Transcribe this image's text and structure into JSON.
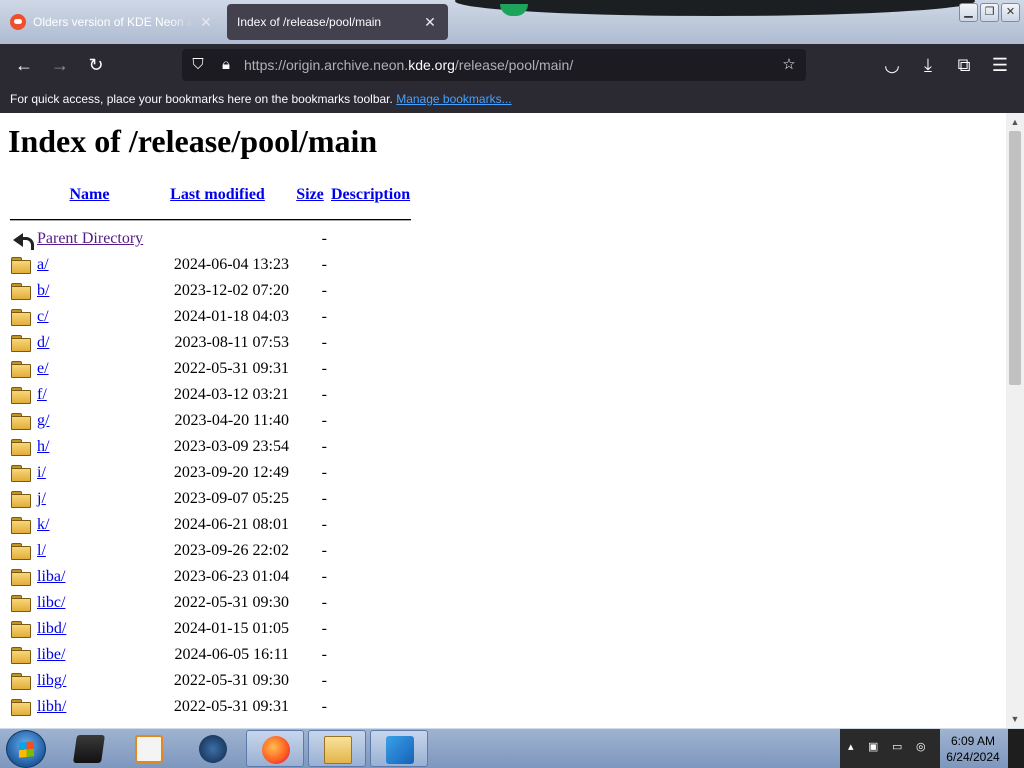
{
  "browser": {
    "tabs": [
      {
        "title": "Olders version of KDE Neon available",
        "active": false
      },
      {
        "title": "Index of /release/pool/main",
        "active": true
      }
    ],
    "url_prefix": "https://origin.archive.neon.",
    "url_domain": "kde.org",
    "url_suffix": "/release/pool/main/",
    "bookmarks_text": "For quick access, place your bookmarks here on the bookmarks toolbar.",
    "manage_bookmarks_label": "Manage bookmarks..."
  },
  "page": {
    "heading": "Index of /release/pool/main",
    "columns": {
      "name": "Name",
      "last_modified": "Last modified",
      "size": "Size",
      "description": "Description"
    },
    "parent": {
      "name": "Parent Directory",
      "size": "-"
    },
    "rows": [
      {
        "name": "a/",
        "modified": "2024-06-04 13:23",
        "size": "-"
      },
      {
        "name": "b/",
        "modified": "2023-12-02 07:20",
        "size": "-"
      },
      {
        "name": "c/",
        "modified": "2024-01-18 04:03",
        "size": "-"
      },
      {
        "name": "d/",
        "modified": "2023-08-11 07:53",
        "size": "-"
      },
      {
        "name": "e/",
        "modified": "2022-05-31 09:31",
        "size": "-"
      },
      {
        "name": "f/",
        "modified": "2024-03-12 03:21",
        "size": "-"
      },
      {
        "name": "g/",
        "modified": "2023-04-20 11:40",
        "size": "-"
      },
      {
        "name": "h/",
        "modified": "2023-03-09 23:54",
        "size": "-"
      },
      {
        "name": "i/",
        "modified": "2023-09-20 12:49",
        "size": "-"
      },
      {
        "name": "j/",
        "modified": "2023-09-07 05:25",
        "size": "-"
      },
      {
        "name": "k/",
        "modified": "2024-06-21 08:01",
        "size": "-"
      },
      {
        "name": "l/",
        "modified": "2023-09-26 22:02",
        "size": "-"
      },
      {
        "name": "liba/",
        "modified": "2023-06-23 01:04",
        "size": "-"
      },
      {
        "name": "libc/",
        "modified": "2022-05-31 09:30",
        "size": "-"
      },
      {
        "name": "libd/",
        "modified": "2024-01-15 01:05",
        "size": "-"
      },
      {
        "name": "libe/",
        "modified": "2024-06-05 16:11",
        "size": "-"
      },
      {
        "name": "libg/",
        "modified": "2022-05-31 09:30",
        "size": "-"
      },
      {
        "name": "libh/",
        "modified": "2022-05-31 09:31",
        "size": "-"
      }
    ]
  },
  "taskbar": {
    "time": "6:09 AM",
    "date": "6/24/2024"
  },
  "icons": {
    "back": "back-arrow-icon",
    "forward": "forward-arrow-icon",
    "reload": "reload-icon",
    "shield": "shield-icon",
    "lock": "lock-icon",
    "star": "star-icon",
    "pocket": "pocket-icon",
    "download": "download-icon",
    "extensions": "extensions-icon",
    "menu": "menu-icon"
  },
  "colors": {
    "link": "#0000ee",
    "visited_link": "#551a8b",
    "toolbar": "#2b2a33",
    "bookmark_link": "#45a1ff"
  }
}
